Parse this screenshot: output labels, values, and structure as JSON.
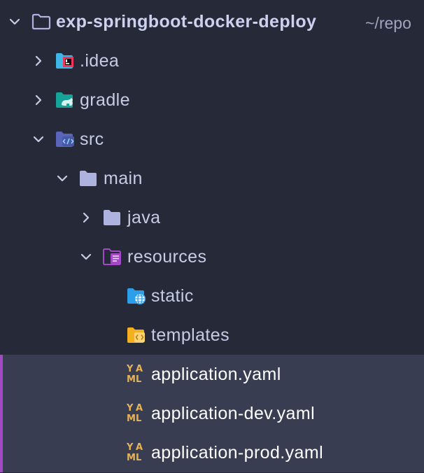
{
  "project_tree": {
    "root": {
      "name": "exp-springboot-docker-deploy",
      "path": "~/repo",
      "expanded": true,
      "icon": "folder-outline-icon"
    },
    "items": [
      {
        "name": ".idea",
        "expanded": false,
        "icon": "idea-folder-icon"
      },
      {
        "name": "gradle",
        "expanded": false,
        "icon": "gradle-folder-icon"
      },
      {
        "name": "src",
        "expanded": true,
        "icon": "source-folder-icon"
      },
      {
        "name": "main",
        "expanded": true,
        "icon": "folder-icon"
      },
      {
        "name": "java",
        "expanded": false,
        "icon": "folder-icon"
      },
      {
        "name": "resources",
        "expanded": true,
        "icon": "resources-folder-icon"
      },
      {
        "name": "static",
        "icon": "web-folder-icon"
      },
      {
        "name": "templates",
        "icon": "templates-folder-icon"
      },
      {
        "name": "application.yaml",
        "icon": "yaml-file-icon",
        "selected": true
      },
      {
        "name": "application-dev.yaml",
        "icon": "yaml-file-icon",
        "selected": true
      },
      {
        "name": "application-prod.yaml",
        "icon": "yaml-file-icon",
        "selected": true
      }
    ],
    "yaml_icon_text": [
      "Y",
      "A",
      "M",
      "L"
    ]
  },
  "colors": {
    "background": "#262937",
    "selection": "#393d52",
    "selection_bar": "#a449c6",
    "folder": "#aeb2de",
    "yaml": "#e8b356"
  }
}
